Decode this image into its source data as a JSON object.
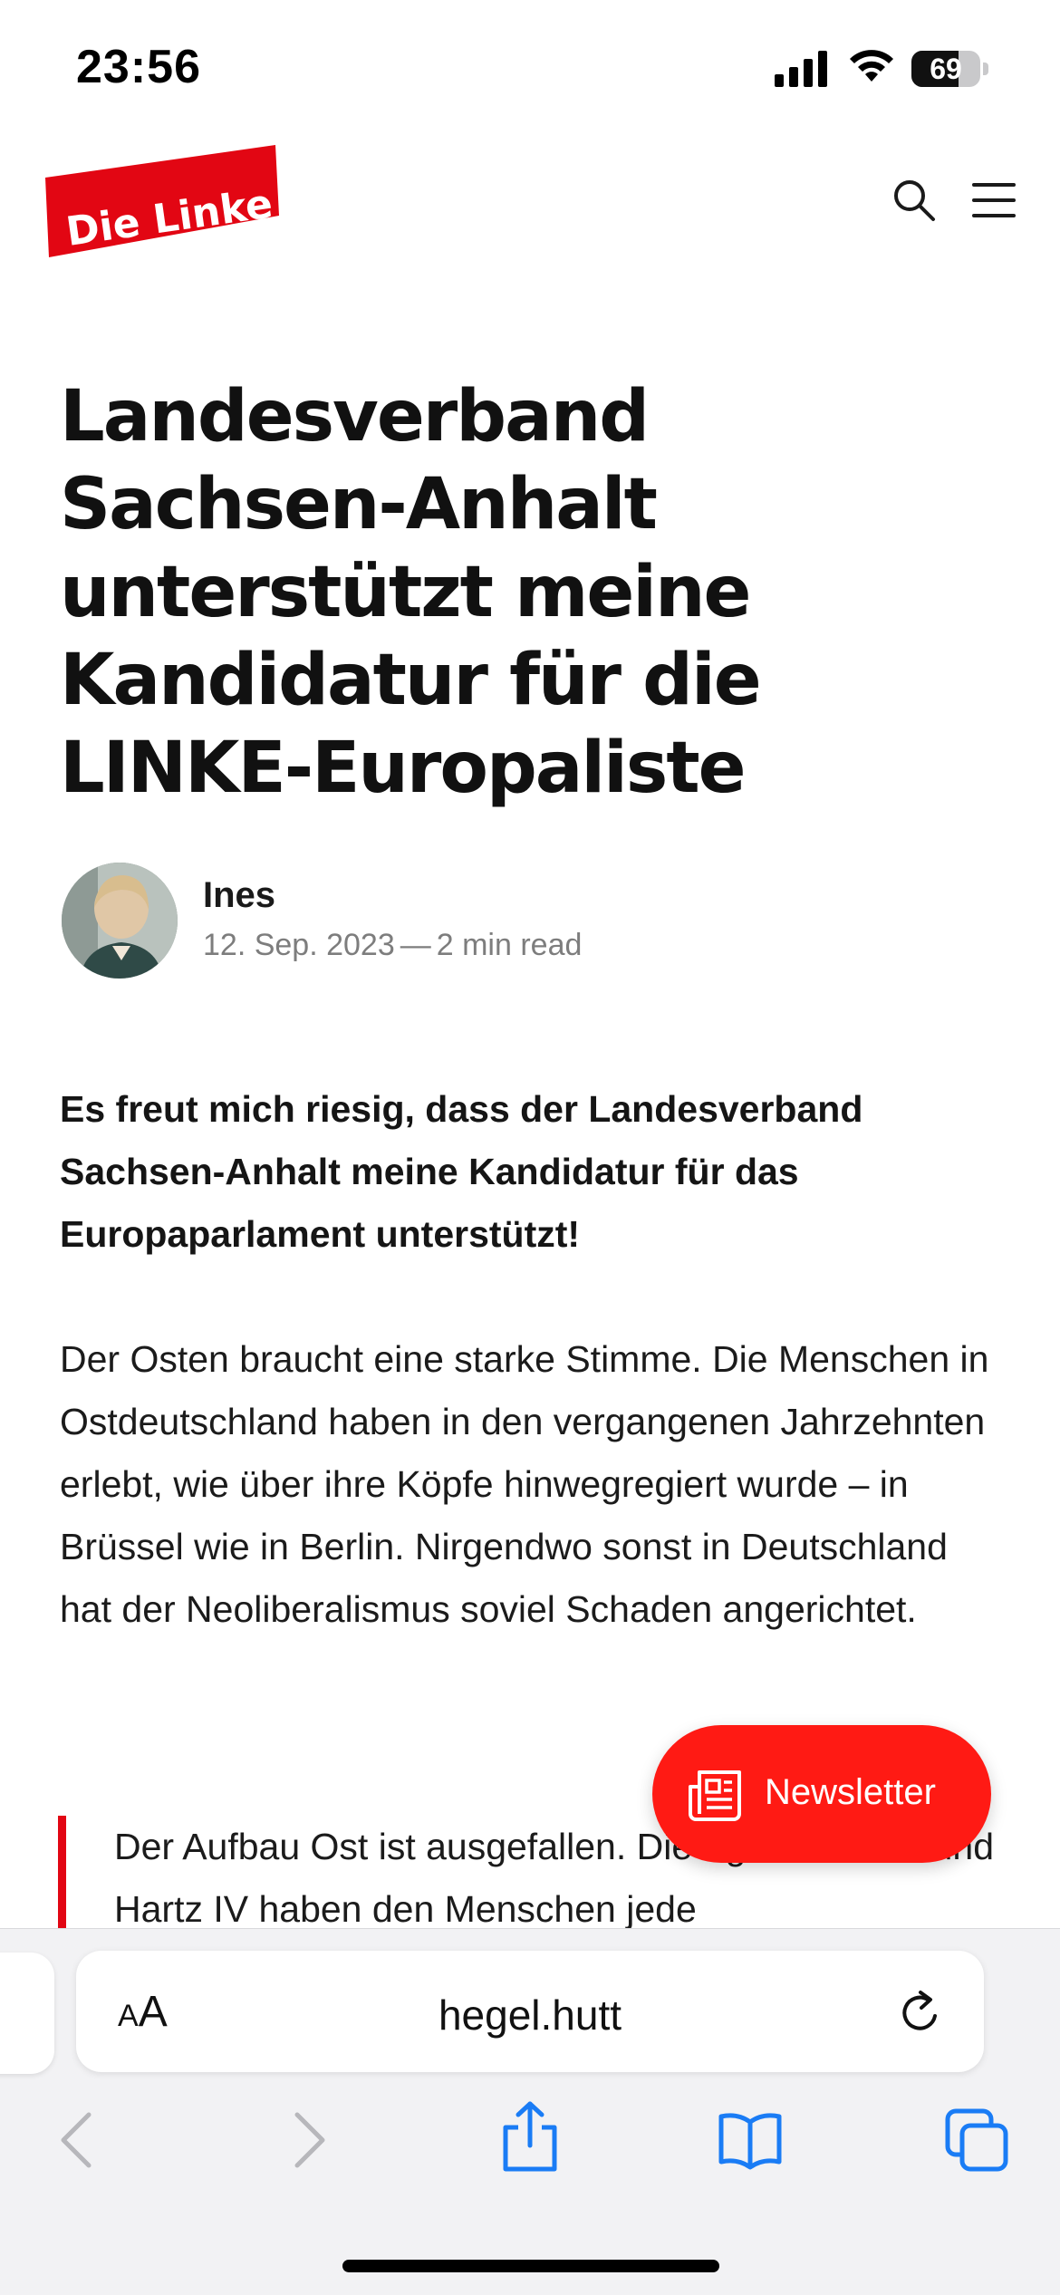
{
  "status_bar": {
    "time": "23:56",
    "battery_level": "69",
    "icons": [
      "cellular-signal-icon",
      "wifi-icon",
      "battery-icon"
    ]
  },
  "header": {
    "logo_text": "Die Linke",
    "logo_color": "#e20613",
    "icons": [
      "search-icon",
      "menu-icon"
    ]
  },
  "article": {
    "title": "Landesverband Sachsen-Anhalt unterstützt meine Kandidatur für die LINKE-Europaliste",
    "author": {
      "name": "Ines",
      "date": "12. Sep. 2023",
      "separator": "—",
      "read_time": "2 min read"
    },
    "lead": "Es freut mich riesig, dass der Landesverband Sachsen-Anhalt meine Kandidatur für das Europaparlament unterstützt!",
    "paragraph": "Der Osten braucht eine starke Stimme. Die Menschen in Ostdeutschland haben in den vergangenen Jahrzehnten erlebt, wie über ihre Köpfe hinwegregiert wurde – in Brüssel wie in Berlin. Nirgendwo sonst in Deutschland hat der Neoliberalismus soviel Schaden angerichtet.",
    "quote": "Der Aufbau Ost ist ausgefallen. Die Agenda 2010 und Hartz IV haben den Menschen jede"
  },
  "newsletter_button": {
    "label": "Newsletter",
    "icon": "newspaper-icon",
    "color": "#ff1a14"
  },
  "browser": {
    "text_size_label_small": "A",
    "text_size_label_large": "A",
    "url": "hegel.hutt",
    "accent_color": "#1a7cf5",
    "toolbar_icons": [
      "back-icon",
      "forward-icon",
      "share-icon",
      "bookmarks-icon",
      "tabs-icon"
    ]
  }
}
